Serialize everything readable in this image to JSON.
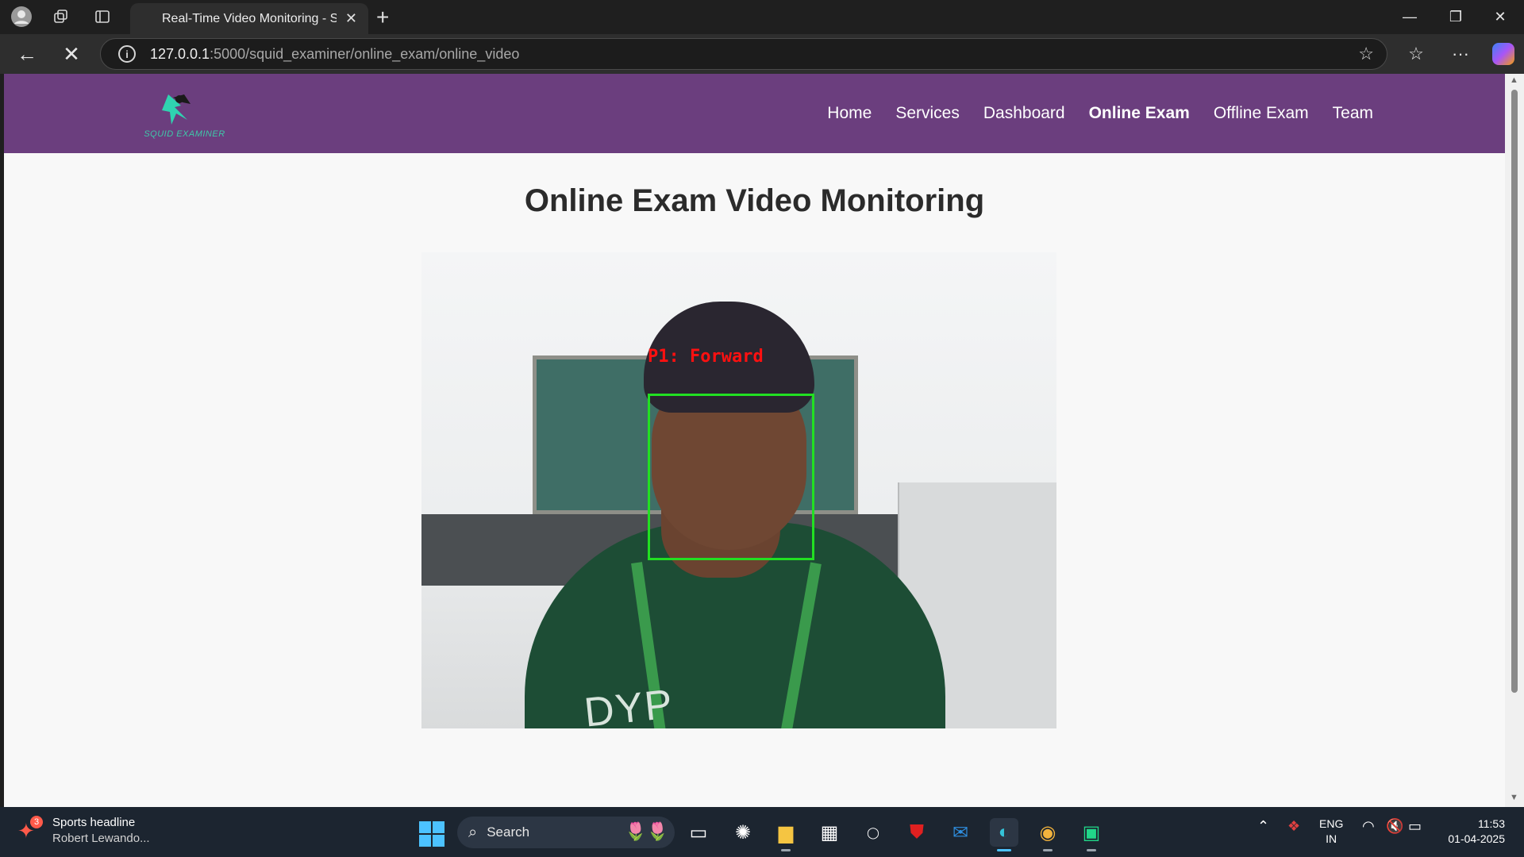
{
  "browser": {
    "tab_title": "Real-Time Video Monitoring - Squid Examiner",
    "url_host": "127.0.0.1",
    "url_path": ":5000/squid_examiner/online_exam/online_video"
  },
  "site": {
    "logo_text": "SQUID EXAMINER",
    "nav": [
      {
        "label": "Home"
      },
      {
        "label": "Services"
      },
      {
        "label": "Dashboard"
      },
      {
        "label": "Online Exam",
        "active": true
      },
      {
        "label": "Offline Exam"
      },
      {
        "label": "Team"
      }
    ],
    "page_title": "Online Exam Video Monitoring",
    "video": {
      "detection_label": "P1: Forward",
      "shirt_text": "DYP",
      "box_color": "#22e022",
      "label_color": "#ff1010"
    }
  },
  "taskbar": {
    "news_title": "Sports headline",
    "news_sub": "Robert Lewando...",
    "news_badge": "3",
    "search_label": "Search",
    "lang": "ENG",
    "region": "IN",
    "time": "11:53",
    "date": "01-04-2025"
  },
  "colors": {
    "navbar": "#6b3e7e",
    "page_bg": "#f8f8f8",
    "accent": "#4cc2ff"
  }
}
